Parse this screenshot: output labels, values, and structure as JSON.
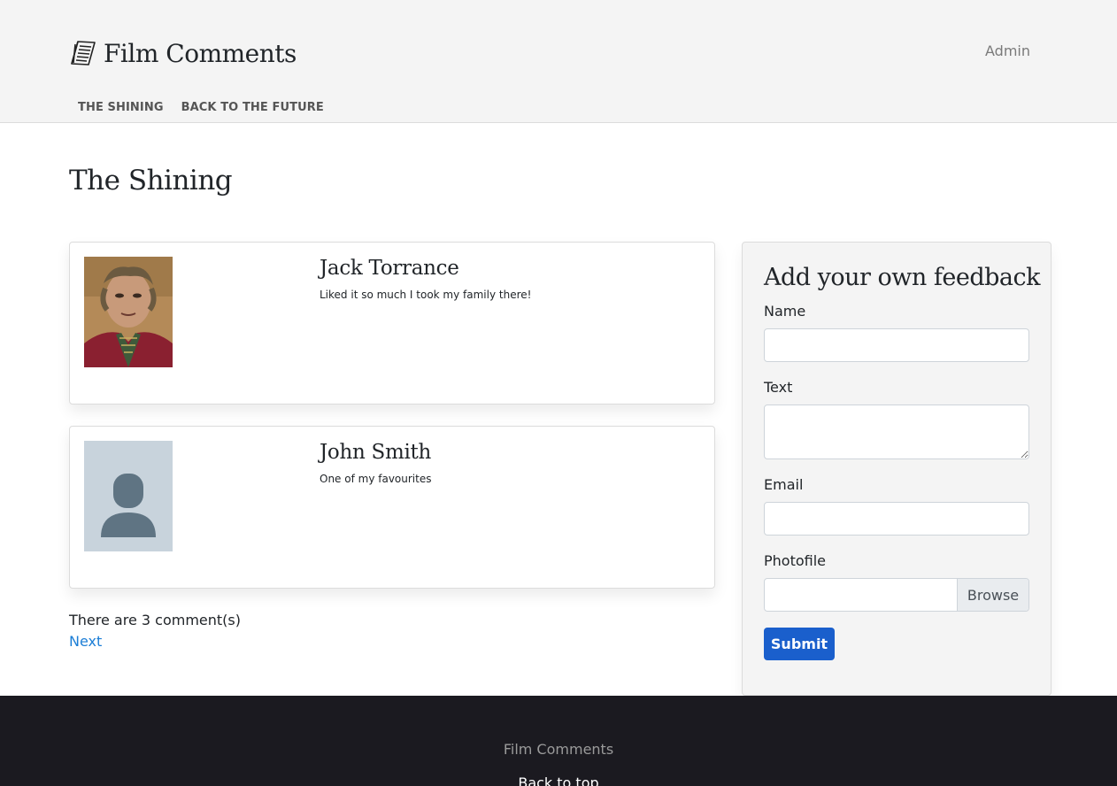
{
  "header": {
    "brand_title": "Film Comments",
    "admin_label": "Admin",
    "nav": [
      {
        "label": "THE SHINING"
      },
      {
        "label": "BACK TO THE FUTURE"
      }
    ]
  },
  "main": {
    "page_title": "The Shining",
    "comments": [
      {
        "author": "Jack Torrance",
        "text": "Liked it so much I took my family there!",
        "photo": "author-photo"
      },
      {
        "author": "John Smith",
        "text": "One of my favourites",
        "photo": "avatar-placeholder-icon"
      }
    ],
    "comment_count": "There are 3 comment(s)",
    "next_label": "Next"
  },
  "feedback_form": {
    "title": "Add your own feedback",
    "name_label": "Name",
    "name_value": "",
    "text_label": "Text",
    "text_value": "",
    "email_label": "Email",
    "email_value": "",
    "photofile_label": "Photofile",
    "browse_label": "Browse",
    "submit_label": "Submit"
  },
  "footer": {
    "title": "Film Comments",
    "back_to_top": "Back to top"
  },
  "colors": {
    "header_bg": "#f4f4f4",
    "link": "#1c7ed6",
    "submit": "#1a5fcc",
    "footer_bg": "#1b1a20"
  }
}
